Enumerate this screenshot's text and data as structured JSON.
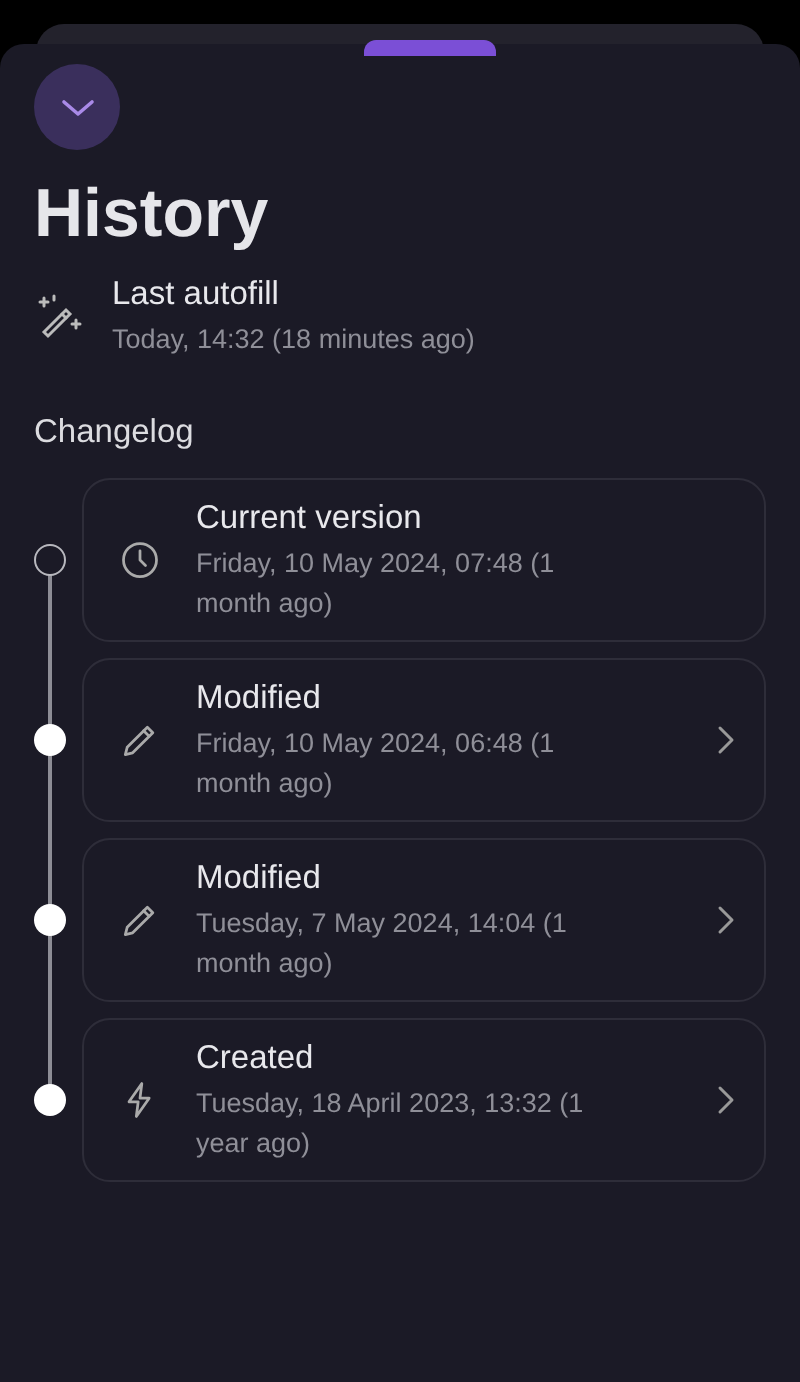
{
  "sheet": {
    "title": "History"
  },
  "autofill": {
    "label": "Last autofill",
    "time": "Today, 14:32 (18 minutes ago)"
  },
  "changelog": {
    "heading": "Changelog",
    "entries": [
      {
        "kind": "clock",
        "title": "Current version",
        "time": "Friday, 10 May 2024, 07:48 (1 month ago)",
        "current": true
      },
      {
        "kind": "pencil",
        "title": "Modified",
        "time": "Friday, 10 May 2024, 06:48 (1 month ago)",
        "current": false
      },
      {
        "kind": "pencil",
        "title": "Modified",
        "time": "Tuesday, 7 May 2024, 14:04 (1 month ago)",
        "current": false
      },
      {
        "kind": "bolt",
        "title": "Created",
        "time": "Tuesday, 18 April 2023, 13:32 (1 year ago)",
        "current": false
      }
    ]
  }
}
